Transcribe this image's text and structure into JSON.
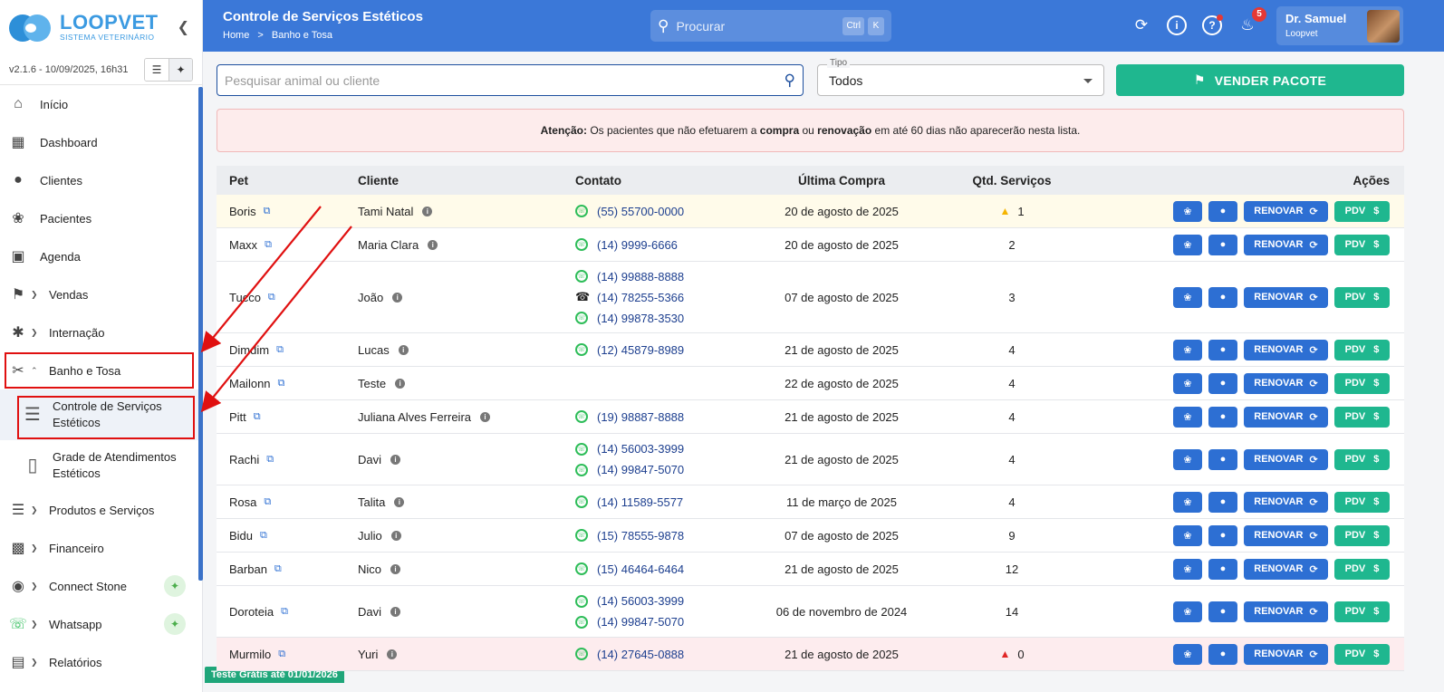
{
  "sidebar": {
    "brand_name": "LOOPVET",
    "brand_sub": "SISTEMA VETERINÁRIO",
    "version": "v2.1.6 - 10/09/2025, 16h31",
    "items": [
      {
        "label": "Início",
        "icon": "home-icon"
      },
      {
        "label": "Dashboard",
        "icon": "dashboard-icon"
      },
      {
        "label": "Clientes",
        "icon": "person-icon"
      },
      {
        "label": "Pacientes",
        "icon": "paw-icon"
      },
      {
        "label": "Agenda",
        "icon": "calendar-icon"
      },
      {
        "label": "Vendas",
        "icon": "tag-icon"
      },
      {
        "label": "Internação",
        "icon": "asterisk-icon"
      },
      {
        "label": "Banho e Tosa",
        "icon": "scissors-icon"
      },
      {
        "label": "Produtos e Serviços",
        "icon": "list-icon"
      },
      {
        "label": "Financeiro",
        "icon": "money-icon"
      },
      {
        "label": "Connect Stone",
        "icon": "wireless-icon"
      },
      {
        "label": "Whatsapp",
        "icon": "whatsapp-icon"
      },
      {
        "label": "Relatórios",
        "icon": "bar-chart-icon"
      }
    ],
    "sub_items": [
      {
        "label": "Controle de Serviços Estéticos"
      },
      {
        "label": "Grade de Atendimentos Estéticos"
      }
    ],
    "trial": "Teste Grátis até 01/01/2026"
  },
  "header": {
    "title": "Controle de Serviços Estéticos",
    "crumb_home": "Home",
    "crumb_sep": ">",
    "crumb_current": "Banho e Tosa",
    "search_placeholder": "Procurar",
    "kbd_ctrl": "Ctrl",
    "kbd_k": "K",
    "notifications": "5",
    "user_name": "Dr. Samuel",
    "user_org": "Loopvet"
  },
  "toolbar": {
    "search_placeholder": "Pesquisar animal ou cliente",
    "tipo_label": "Tipo",
    "tipo_value": "Todos",
    "sell_label": "VENDER PACOTE"
  },
  "alert": {
    "prefix": "Atenção:",
    "t1": " Os pacientes que não efetuarem a ",
    "b1": "compra",
    "t2": " ou ",
    "b2": "renovação",
    "t3": " em até 60 dias não aparecerão nesta lista."
  },
  "table": {
    "headers": {
      "pet": "Pet",
      "cliente": "Cliente",
      "contato": "Contato",
      "ultima": "Última Compra",
      "qtd": "Qtd. Serviços",
      "acoes": "Ações"
    },
    "renew_label": "RENOVAR",
    "pdv_label": "PDV",
    "rows": [
      {
        "pet": "Boris",
        "cliente": "Tami Natal",
        "phones": [
          {
            "type": "whatsapp",
            "n": "(55) 55700-0000"
          }
        ],
        "ultima": "20 de agosto de 2025",
        "qtd": "1",
        "status": "warn"
      },
      {
        "pet": "Maxx",
        "cliente": "Maria Clara",
        "phones": [
          {
            "type": "whatsapp",
            "n": "(14) 9999-6666"
          }
        ],
        "ultima": "20 de agosto de 2025",
        "qtd": "2",
        "status": ""
      },
      {
        "pet": "Tucco",
        "cliente": "João",
        "phones": [
          {
            "type": "whatsapp",
            "n": "(14) 99888-8888"
          },
          {
            "type": "phone",
            "n": "(14) 78255-5366"
          },
          {
            "type": "whatsapp",
            "n": "(14) 99878-3530"
          }
        ],
        "ultima": "07 de agosto de 2025",
        "qtd": "3",
        "status": ""
      },
      {
        "pet": "Dimdim",
        "cliente": "Lucas",
        "phones": [
          {
            "type": "whatsapp",
            "n": "(12) 45879-8989"
          }
        ],
        "ultima": "21 de agosto de 2025",
        "qtd": "4",
        "status": ""
      },
      {
        "pet": "Mailonn",
        "cliente": "Teste",
        "phones": [],
        "ultima": "22 de agosto de 2025",
        "qtd": "4",
        "status": ""
      },
      {
        "pet": "Pitt",
        "cliente": "Juliana Alves Ferreira",
        "phones": [
          {
            "type": "whatsapp",
            "n": "(19) 98887-8888"
          }
        ],
        "ultima": "21 de agosto de 2025",
        "qtd": "4",
        "status": ""
      },
      {
        "pet": "Rachi",
        "cliente": "Davi",
        "phones": [
          {
            "type": "whatsapp",
            "n": "(14) 56003-3999"
          },
          {
            "type": "whatsapp",
            "n": "(14) 99847-5070"
          }
        ],
        "ultima": "21 de agosto de 2025",
        "qtd": "4",
        "status": ""
      },
      {
        "pet": "Rosa",
        "cliente": "Talita",
        "phones": [
          {
            "type": "whatsapp",
            "n": "(14) 11589-5577"
          }
        ],
        "ultima": "11 de março de 2025",
        "qtd": "4",
        "status": ""
      },
      {
        "pet": "Bidu",
        "cliente": "Julio",
        "phones": [
          {
            "type": "whatsapp",
            "n": "(15) 78555-9878"
          }
        ],
        "ultima": "07 de agosto de 2025",
        "qtd": "9",
        "status": ""
      },
      {
        "pet": "Barban",
        "cliente": "Nico",
        "phones": [
          {
            "type": "whatsapp",
            "n": "(15) 46464-6464"
          }
        ],
        "ultima": "21 de agosto de 2025",
        "qtd": "12",
        "status": ""
      },
      {
        "pet": "Doroteia",
        "cliente": "Davi",
        "phones": [
          {
            "type": "whatsapp",
            "n": "(14) 56003-3999"
          },
          {
            "type": "whatsapp",
            "n": "(14) 99847-5070"
          }
        ],
        "ultima": "06 de novembro de 2024",
        "qtd": "14",
        "status": ""
      },
      {
        "pet": "Murmilo",
        "cliente": "Yuri",
        "phones": [
          {
            "type": "whatsapp",
            "n": "(14) 27645-0888"
          }
        ],
        "ultima": "21 de agosto de 2025",
        "qtd": "0",
        "status": "danger"
      }
    ]
  },
  "colors": {
    "header": "#3b78d8",
    "primary": "#2d6fd3",
    "success": "#1fb78f",
    "annotation": "#e01010"
  }
}
